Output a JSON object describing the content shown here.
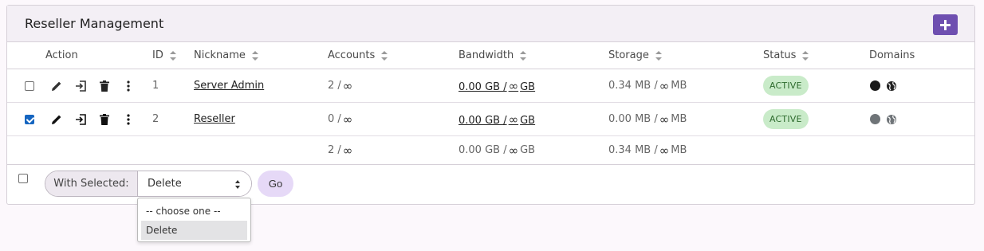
{
  "card": {
    "title": "Reseller Management"
  },
  "table": {
    "headers": {
      "action": "Action",
      "id": "ID",
      "nickname": "Nickname",
      "accounts": "Accounts",
      "bandwidth": "Bandwidth",
      "storage": "Storage",
      "status": "Status",
      "domains": "Domains"
    },
    "rows": [
      {
        "checked": false,
        "id": "1",
        "nickname": "Server Admin",
        "accounts_used": "2 /",
        "bandwidth_used": "0.00 GB /",
        "bandwidth_unit": "GB",
        "storage_used": "0.34 MB /",
        "storage_unit": "MB",
        "status": "ACTIVE",
        "domain_dot_color": "#1a1a1a"
      },
      {
        "checked": true,
        "id": "2",
        "nickname": "Reseller",
        "accounts_used": "0 /",
        "bandwidth_used": "0.00 GB /",
        "bandwidth_unit": "GB",
        "storage_used": "0.00 MB /",
        "storage_unit": "MB",
        "status": "ACTIVE",
        "domain_dot_color": "#6f7478"
      }
    ],
    "totals": {
      "accounts": "2 /",
      "bandwidth": "0.00 GB /",
      "bandwidth_unit": "GB",
      "storage": "0.34 MB /",
      "storage_unit": "MB"
    },
    "infinity_symbol": "∞"
  },
  "bulk": {
    "label": "With Selected:",
    "selected": "Delete",
    "go_label": "Go",
    "options": [
      "-- choose one --",
      "Delete"
    ]
  },
  "colors": {
    "accent": "#6e4fb0",
    "status_bg": "#c9ebc9",
    "status_text": "#2e6b2e",
    "go_bg": "#e6d9f7"
  },
  "icons": [
    "plus-icon",
    "pencil-icon",
    "login-icon",
    "trash-icon",
    "more-vertical-icon",
    "globe-icon"
  ]
}
